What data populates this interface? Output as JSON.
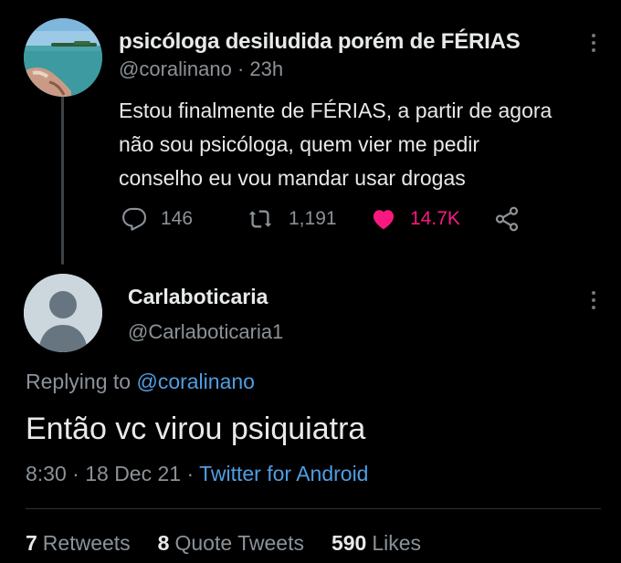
{
  "tweet": {
    "display_name": "psicóloga desiludida porém de FÉRIAS",
    "handle": "@coralinano",
    "time": "23h",
    "lines": [
      "Estou finalmente de FÉRIAS, a partir de agora",
      "não sou psicóloga, quem vier me pedir",
      "conselho eu vou mandar usar drogas"
    ],
    "reply_count": "146",
    "retweet_count": "1,191",
    "like_count": "14.7K"
  },
  "reply": {
    "display_name": "Carlaboticaria",
    "handle": "@Carlaboticaria1",
    "replying_prefix": "Replying to",
    "replying_to": "@coralinano",
    "text": "Então vc virou psiquiatra",
    "time": "8:30",
    "date": "18 Dec 21",
    "source": "Twitter for Android"
  },
  "stats": {
    "retweets_count": "7",
    "retweets_label": "Retweets",
    "quotes_count": "8",
    "quotes_label": "Quote Tweets",
    "likes_count": "590",
    "likes_label": "Likes"
  },
  "colors": {
    "background": "#000000",
    "primary_text": "#e7e9ea",
    "secondary_text": "#8b9298",
    "link": "#4f9ee3",
    "like": "#f91880"
  },
  "icons": {
    "reply": "comment-bubble-icon",
    "retweet": "retweet-icon",
    "like": "heart-filled-icon",
    "share": "share-icon",
    "more": "more-vertical-icon"
  }
}
